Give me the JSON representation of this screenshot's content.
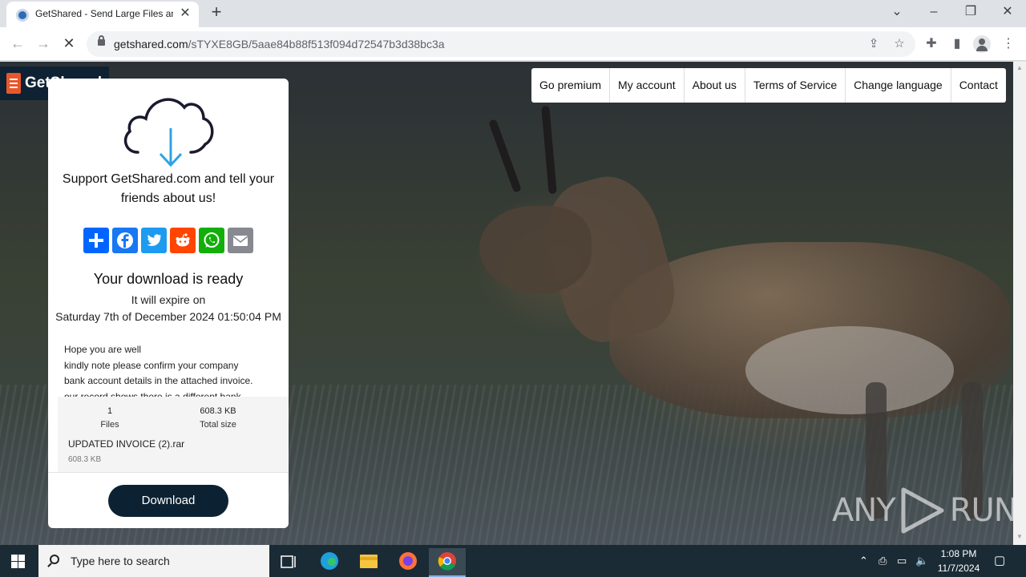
{
  "browser": {
    "tab_title": "GetShared - Send Large Files and",
    "url_host": "getshared.com",
    "url_path": "/sTYXE8GB/5aae84b88f513f094d72547b3d38bc3a"
  },
  "site": {
    "logo_text": "GetShared",
    "nav": [
      "Go premium",
      "My account",
      "About us",
      "Terms of Service",
      "Change language",
      "Contact"
    ]
  },
  "card": {
    "support_line1": "Support GetShared.com and tell your",
    "support_line2": "friends about us!",
    "share_buttons": [
      {
        "name": "share",
        "color": "#0166ff"
      },
      {
        "name": "facebook",
        "color": "#1877f2"
      },
      {
        "name": "twitter",
        "color": "#1d9bf0"
      },
      {
        "name": "reddit",
        "color": "#ff4500"
      },
      {
        "name": "whatsapp",
        "color": "#12af0a"
      },
      {
        "name": "email",
        "color": "#888990"
      }
    ],
    "ready_title": "Your download is ready",
    "expire_label": "It will expire on",
    "expire_date": "Saturday 7th of December 2024 01:50:04 PM",
    "message_lines": [
      "Hope you are well",
      "kindly note please confirm your company",
      "bank account details in the attached invoice.",
      "our record shows there is a different bank"
    ],
    "files_count": "1",
    "files_label": "Files",
    "total_size": "608.3 KB",
    "total_size_label": "Total size",
    "file_name": "UPDATED INVOICE (2).rar",
    "file_size": "608.3 KB",
    "download_label": "Download"
  },
  "watermark": {
    "left": "ANY",
    "right": "RUN"
  },
  "taskbar": {
    "search_placeholder": "Type here to search",
    "time": "1:08 PM",
    "date": "11/7/2024"
  },
  "colors": {
    "brand_dark": "#0c2233",
    "accent_orange": "#e8572c",
    "cloud_arrow": "#2da3e6"
  }
}
